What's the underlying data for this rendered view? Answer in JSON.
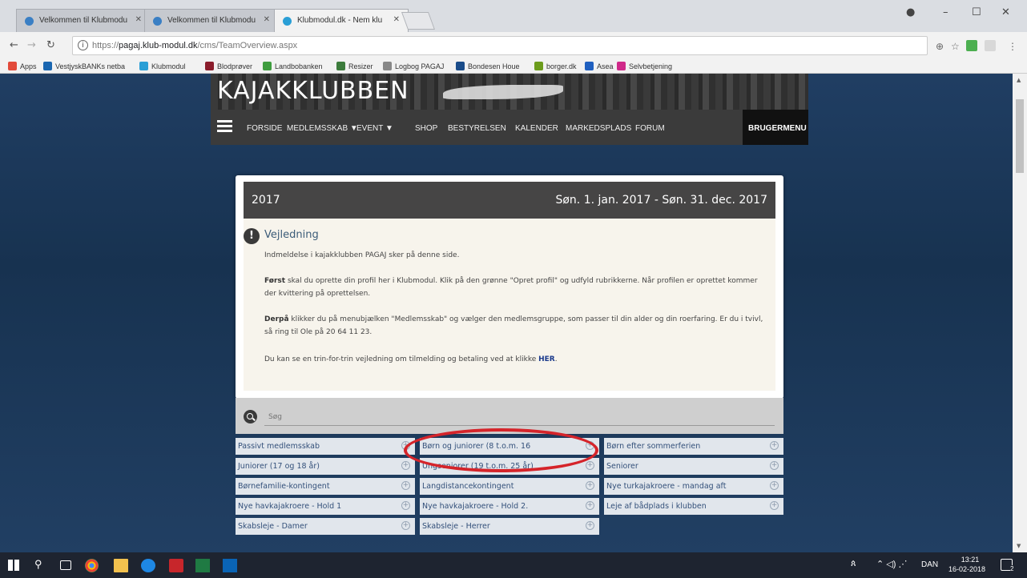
{
  "browser": {
    "tabs": [
      {
        "label": "Velkommen til Klubmodu",
        "active": false
      },
      {
        "label": "Velkommen til Klubmodu",
        "active": false
      },
      {
        "label": "Klubmodul.dk - Nem klu",
        "active": true
      }
    ],
    "url_prefix": "https://",
    "url_host": "pagaj.klub-modul.dk",
    "url_path": "/cms/TeamOverview.aspx",
    "bookmarks": [
      {
        "label": "Apps",
        "color": "#e24a3a"
      },
      {
        "label": "VestjyskBANKs netba",
        "color": "#1a66b0"
      },
      {
        "label": "Klubmodul",
        "color": "#2a9fd6"
      },
      {
        "label": "Blodprøver",
        "color": "#8b1d2c"
      },
      {
        "label": "Landbobanken",
        "color": "#3f9d3f"
      },
      {
        "label": "Resizer",
        "color": "#3c7c3c"
      },
      {
        "label": "Logbog PAGAJ",
        "color": "#888888"
      },
      {
        "label": "Bondesen Houe",
        "color": "#1a4c8a"
      },
      {
        "label": "borger.dk",
        "color": "#6c9c1c"
      },
      {
        "label": "Asea",
        "color": "#2060c0"
      },
      {
        "label": "Selvbetjening",
        "color": "#d02a8a"
      }
    ]
  },
  "site": {
    "logo_text": "KAJAKKLUBBEN",
    "nav": [
      "FORSIDE",
      "MEDLEMSSKAB ▼",
      "EVENT ▼",
      "SHOP",
      "BESTYRELSEN",
      "KALENDER",
      "MARKEDSPLADS",
      "FORUM"
    ],
    "user_menu": "BRUGERMENU"
  },
  "card": {
    "year": "2017",
    "date_range": "Søn. 1. jan. 2017  -  Søn. 31. dec. 2017",
    "title": "Vejledning",
    "intro": "Indmeldelse i kajakklubben PAGAJ sker på denne side.",
    "first_bold": "Først",
    "first_text": " skal du oprette din profil her i Klubmodul. Klik på den grønne \"Opret profil\" og udfyld rubrikkerne. Når profilen er oprettet kommer der kvittering på oprettelsen.",
    "then_bold": "Derpå",
    "then_text": " klikker du på menubjælken \"Medlemsskab\" og vælger den medlemsgruppe, som passer til din alder og din roerfaring. Er du i tvivl, så ring til Ole på 20 64 11 23.",
    "guide_text": "Du kan se en trin-for-trin vejledning om tilmelding og betaling ved at klikke ",
    "guide_link": "HER",
    "guide_end": "."
  },
  "search": {
    "placeholder": "Søg"
  },
  "teams": [
    "Passivt medlemsskab",
    "Børn og juniorer (8 t.o.m. 16",
    "Børn efter sommerferien",
    "Juniorer (17 og 18 år)",
    "Ungseniorer (19 t.o.m. 25 år)",
    "Seniorer",
    "Børnefamilie-kontingent",
    "Langdistancekontingent",
    "Nye turkajakroere - mandag aft",
    "Nye havkajakroere - Hold 1",
    "Nye havkajakroere - Hold 2.",
    "Leje af bådplads i klubben",
    "Skabsleje - Damer",
    "Skabsleje - Herrer"
  ],
  "taskbar": {
    "language": "DAN",
    "time": "13:21",
    "date": "16-02-2018",
    "notifications": "2"
  }
}
